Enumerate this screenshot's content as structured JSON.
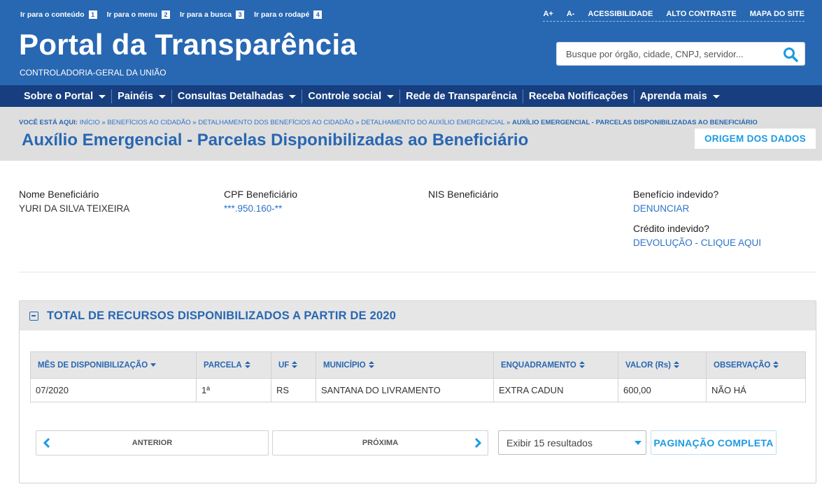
{
  "skip_links": [
    {
      "label": "Ir para o conteúdo",
      "key": "1"
    },
    {
      "label": "Ir para o menu",
      "key": "2"
    },
    {
      "label": "Ir para a busca",
      "key": "3"
    },
    {
      "label": "Ir para o rodapé",
      "key": "4"
    }
  ],
  "top_tools": [
    "A+",
    "A-",
    "ACESSIBILIDADE",
    "ALTO CONTRASTE",
    "MAPA DO SITE"
  ],
  "brand": {
    "title": "Portal da Transparência",
    "subtitle": "CONTROLADORIA-GERAL DA UNIÃO"
  },
  "search": {
    "placeholder": "Busque por órgão, cidade, CNPJ, servidor..."
  },
  "nav": [
    {
      "label": "Sobre o Portal",
      "dropdown": true
    },
    {
      "label": "Painéis",
      "dropdown": true
    },
    {
      "label": "Consultas Detalhadas",
      "dropdown": true
    },
    {
      "label": "Controle social",
      "dropdown": true
    },
    {
      "label": "Rede de Transparência",
      "dropdown": false
    },
    {
      "label": "Receba Notificações",
      "dropdown": false
    },
    {
      "label": "Aprenda mais",
      "dropdown": true
    }
  ],
  "breadcrumb": {
    "lead": "VOCÊ ESTÁ AQUI:",
    "items": [
      "INÍCIO",
      "BENEFÍCIOS AO CIDADÃO",
      "DETALHAMENTO DOS BENEFÍCIOS AO CIDADÃO",
      "DETALHAMENTO DO AUXÍLIO EMERGENCIAL"
    ],
    "current": "AUXÍLIO EMERGENCIAL - PARCELAS DISPONIBILIZADAS AO BENEFICIÁRIO",
    "separator": " » "
  },
  "page": {
    "title": "Auxílio Emergencial - Parcelas Disponibilizadas ao Beneficiário",
    "origin_button": "ORIGEM DOS DADOS"
  },
  "beneficiary": {
    "name_label": "Nome Beneficiário",
    "name_value": "YURI DA SILVA TEIXEIRA",
    "cpf_label": "CPF Beneficiário",
    "cpf_value": "***.950.160-**",
    "nis_label": "NIS Beneficiário",
    "nis_value": "",
    "undue_benefit_label": "Benefício indevido?",
    "undue_benefit_link": "DENUNCIAR",
    "undue_credit_label": "Crédito indevido?",
    "undue_credit_link": "DEVOLUÇÃO - CLIQUE AQUI"
  },
  "panel": {
    "title": "TOTAL DE RECURSOS DISPONIBILIZADOS A PARTIR DE 2020"
  },
  "table": {
    "columns": [
      "MÊS DE DISPONIBILIZAÇÃO",
      "PARCELA",
      "UF",
      "MUNICÍPIO",
      "ENQUADRAMENTO",
      "VALOR (Rs)",
      "OBSERVAÇÃO"
    ],
    "rows": [
      [
        "07/2020",
        "1ª",
        "RS",
        "SANTANA DO LIVRAMENTO",
        "EXTRA CADUN",
        "600,00",
        "NÃO HÁ"
      ]
    ]
  },
  "pagination": {
    "previous": "ANTERIOR",
    "next": "PRÓXIMA",
    "page_size": "Exibir 15 resultados",
    "full": "PAGINAÇÃO COMPLETA"
  },
  "colors": {
    "header_blue": "#2867b2",
    "nav_dark_blue": "#173f80",
    "accent_cyan": "#1b9ae4",
    "title_bar_gray": "#dedede"
  }
}
